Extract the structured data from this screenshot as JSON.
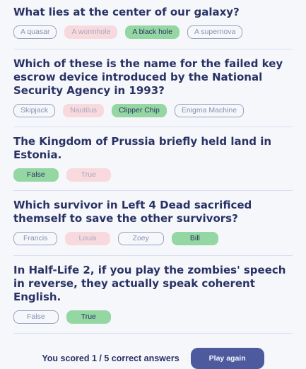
{
  "questions": [
    {
      "text": "What lies at the center of our galaxy?",
      "answers": [
        {
          "label": "A quasar",
          "state": "neutral"
        },
        {
          "label": "A wormhole",
          "state": "wrong"
        },
        {
          "label": "A black hole",
          "state": "right"
        },
        {
          "label": "A supernova",
          "state": "neutral"
        }
      ]
    },
    {
      "text": "Which of these is the name for the failed key escrow device introduced by the National Security Agency in 1993?",
      "answers": [
        {
          "label": "Skipjack",
          "state": "neutral"
        },
        {
          "label": "Nautilus",
          "state": "wrong"
        },
        {
          "label": "Clipper Chip",
          "state": "right"
        },
        {
          "label": "Enigma Machine",
          "state": "neutral"
        }
      ]
    },
    {
      "text": "The Kingdom of Prussia briefly held land in Estonia.",
      "answers": [
        {
          "label": "False",
          "state": "right"
        },
        {
          "label": "True",
          "state": "wrong"
        }
      ]
    },
    {
      "text": "Which survivor in Left 4 Dead sacrificed themself to save the other survivors?",
      "answers": [
        {
          "label": "Francis",
          "state": "neutral"
        },
        {
          "label": "Louis",
          "state": "wrong"
        },
        {
          "label": "Zoey",
          "state": "neutral"
        },
        {
          "label": "Bill",
          "state": "right"
        }
      ]
    },
    {
      "text": "In Half-Life 2, if you play the zombies' speech in reverse, they actually speak coherent English.",
      "answers": [
        {
          "label": "False",
          "state": "neutral"
        },
        {
          "label": "True",
          "state": "right"
        }
      ]
    }
  ],
  "footer": {
    "score_text": "You scored 1 / 5 correct answers",
    "play_again_label": "Play again"
  },
  "colors": {
    "background": "#f5f7fb",
    "text": "#293264",
    "correct": "#94d7a2",
    "incorrect": "#f8d9dd",
    "button": "#4d5b9e"
  }
}
